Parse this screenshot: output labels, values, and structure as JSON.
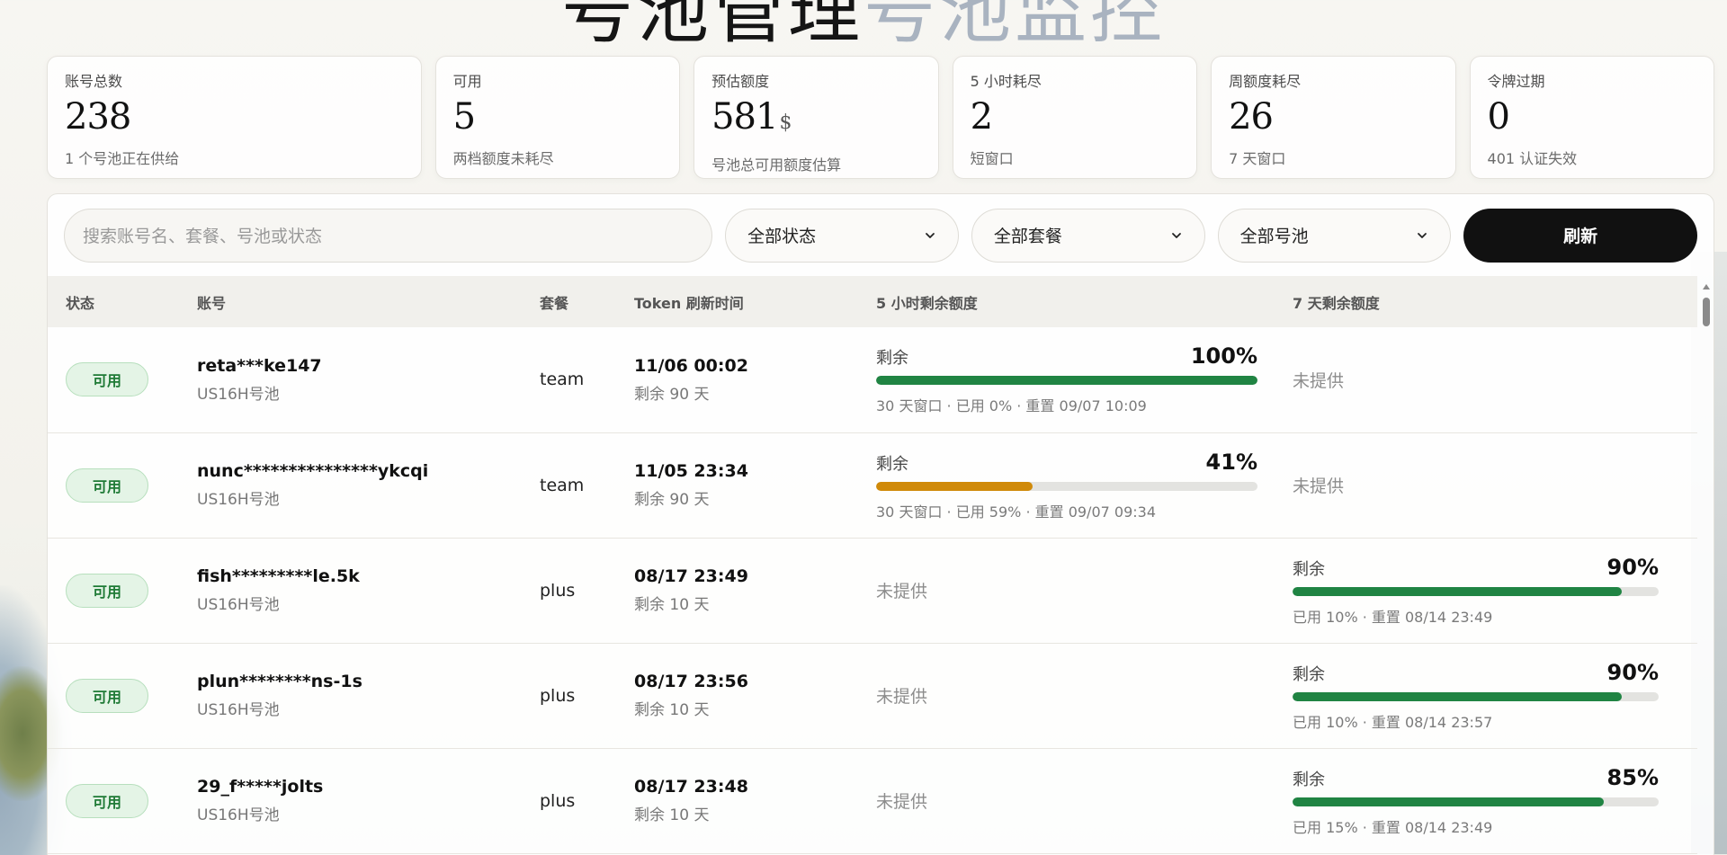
{
  "hero": {
    "title_main": "号池管理",
    "title_accent": "号池监控"
  },
  "stats": [
    {
      "label": "账号总数",
      "value": "238",
      "unit": "",
      "sub": "1 个号池正在供给"
    },
    {
      "label": "可用",
      "value": "5",
      "unit": "",
      "sub": "两档额度未耗尽"
    },
    {
      "label": "预估额度",
      "value": "581",
      "unit": "$",
      "sub": "号池总可用额度估算"
    },
    {
      "label": "5 小时耗尽",
      "value": "2",
      "unit": "",
      "sub": "短窗口"
    },
    {
      "label": "周额度耗尽",
      "value": "26",
      "unit": "",
      "sub": "7 天窗口"
    },
    {
      "label": "令牌过期",
      "value": "0",
      "unit": "",
      "sub": "401 认证失效"
    }
  ],
  "toolbar": {
    "search_placeholder": "搜索账号名、套餐、号池或状态",
    "status_filter": "全部状态",
    "plan_filter": "全部套餐",
    "pool_filter": "全部号池",
    "refresh_label": "刷新"
  },
  "table": {
    "headers": {
      "status": "状态",
      "account": "账号",
      "plan": "套餐",
      "token": "Token 刷新时间",
      "quota_5h": "5 小时剩余额度",
      "quota_7d": "7 天剩余额度"
    },
    "remaining_label": "剩余",
    "na_label": "未提供",
    "rows": [
      {
        "status": "可用",
        "account": "reta***ke147",
        "pool": "US16H号池",
        "plan": "team",
        "token_time": "11/06 00:02",
        "token_left": "剩余 90 天",
        "q5": {
          "pct": "100%",
          "fraction": 1.0,
          "color": "#208443",
          "meta": "30 天窗口 · 已用 0% · 重置 09/07 10:09"
        },
        "q7": null
      },
      {
        "status": "可用",
        "account": "nunc***************ykcqi",
        "pool": "US16H号池",
        "plan": "team",
        "token_time": "11/05 23:34",
        "token_left": "剩余 90 天",
        "q5": {
          "pct": "41%",
          "fraction": 0.41,
          "color": "#d08a09",
          "meta": "30 天窗口 · 已用 59% · 重置 09/07 09:34"
        },
        "q7": null
      },
      {
        "status": "可用",
        "account": "fish*********le.5k",
        "pool": "US16H号池",
        "plan": "plus",
        "token_time": "08/17 23:49",
        "token_left": "剩余 10 天",
        "q5": null,
        "q7": {
          "pct": "90%",
          "fraction": 0.9,
          "color": "#208443",
          "meta": "已用 10% · 重置 08/14 23:49"
        }
      },
      {
        "status": "可用",
        "account": "plun********ns-1s",
        "pool": "US16H号池",
        "plan": "plus",
        "token_time": "08/17 23:56",
        "token_left": "剩余 10 天",
        "q5": null,
        "q7": {
          "pct": "90%",
          "fraction": 0.9,
          "color": "#208443",
          "meta": "已用 10% · 重置 08/14 23:57"
        }
      },
      {
        "status": "可用",
        "account": "29_f*****jolts",
        "pool": "US16H号池",
        "plan": "plus",
        "token_time": "08/17 23:48",
        "token_left": "剩余 10 天",
        "q5": null,
        "q7": {
          "pct": "85%",
          "fraction": 0.85,
          "color": "#208443",
          "meta": "已用 15% · 重置 08/14 23:49"
        }
      }
    ]
  },
  "icons": {
    "select_chevron": "chevron-down-icon",
    "scroll_up": "scroll-up-arrow-icon"
  }
}
